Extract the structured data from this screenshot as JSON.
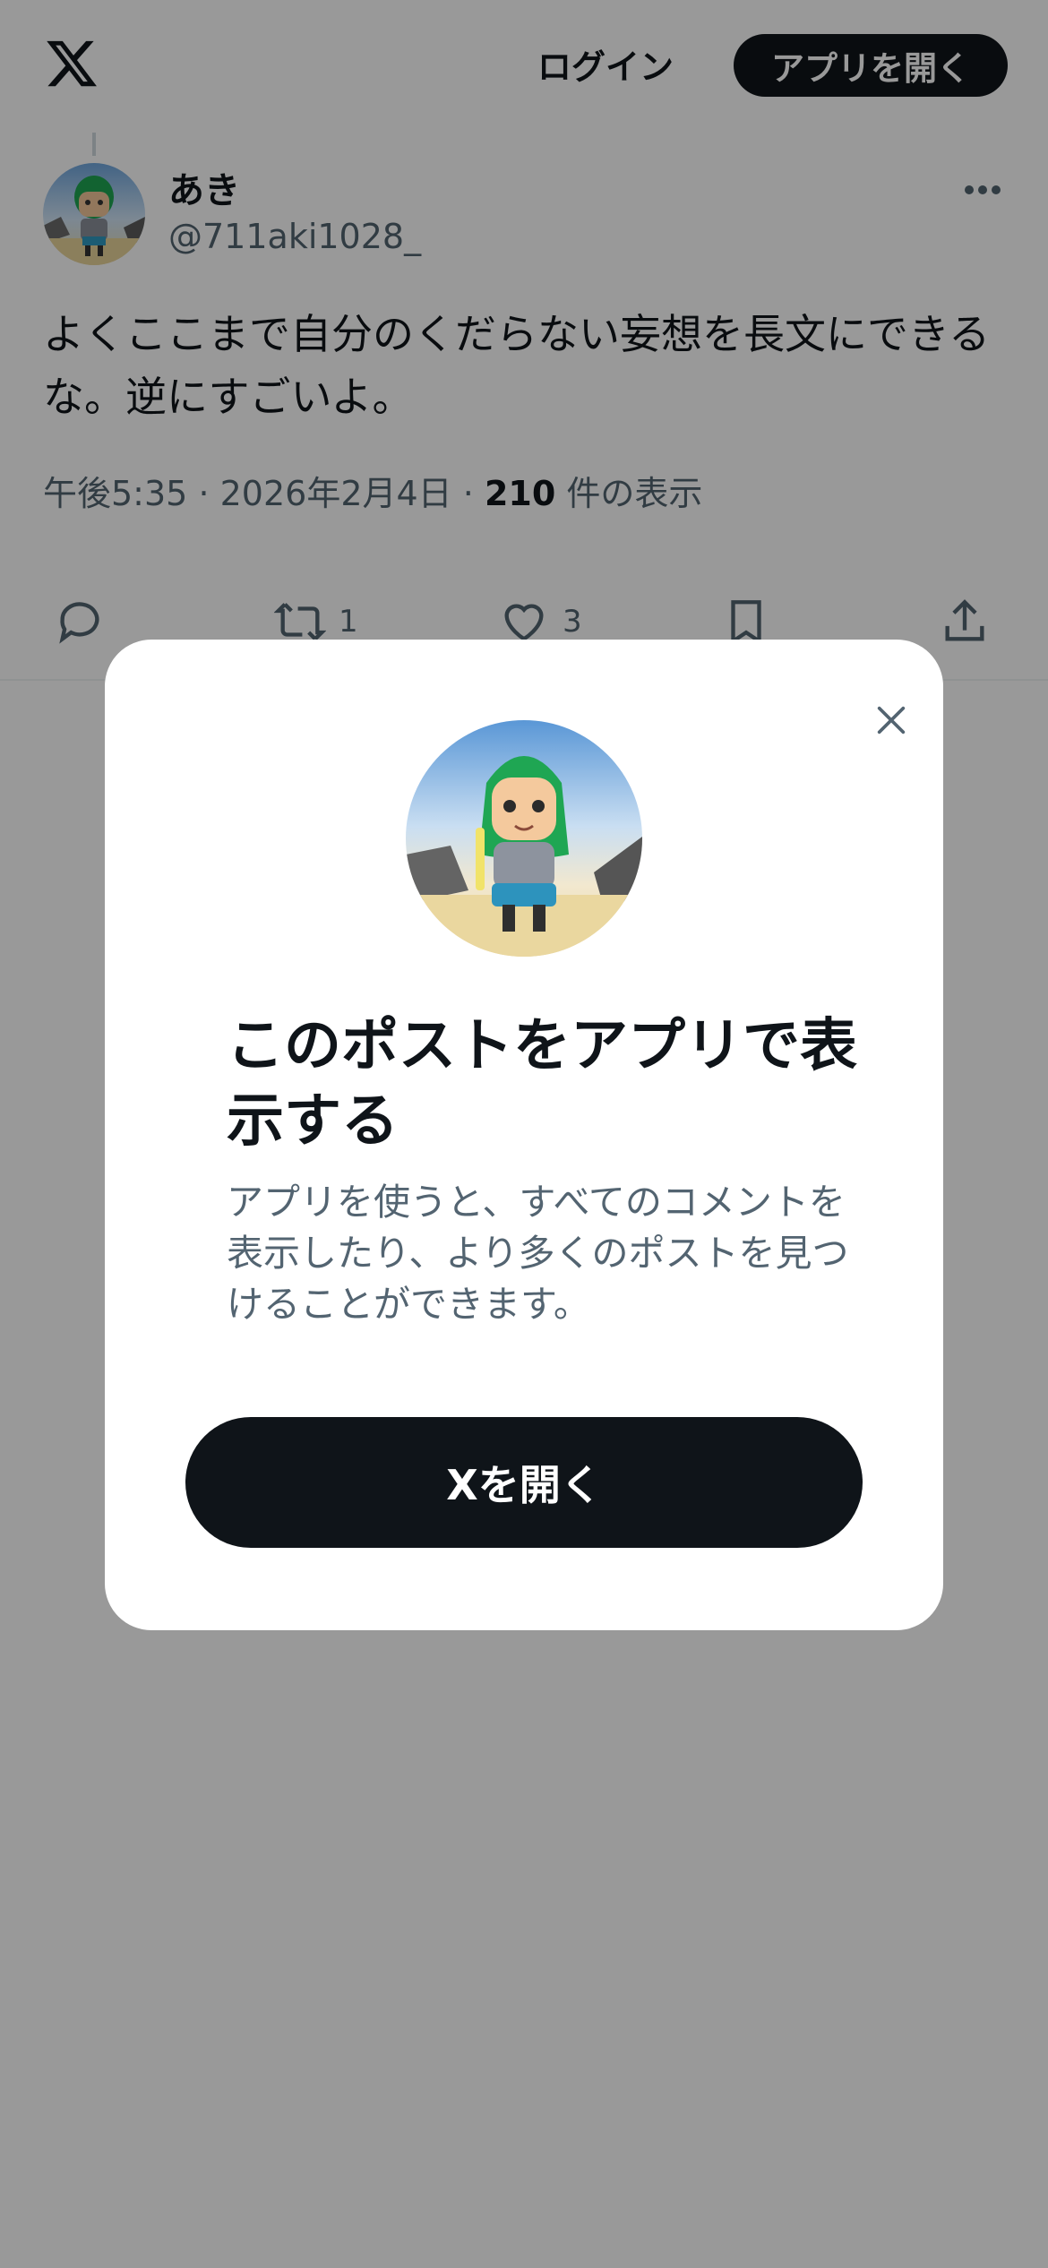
{
  "header": {
    "logo_icon": "x-logo-icon",
    "login_label": "ログイン",
    "open_app_label": "アプリを開く"
  },
  "tweet": {
    "display_name": "あき",
    "handle": "@711aki1028_",
    "text": "よくここまで自分のくだらない妄想を長文にできるな。逆にすごいよ。",
    "time": "午後5:35",
    "separator": "·",
    "date": "2026年2月4日",
    "views_count": "210",
    "views_label": "件の表示",
    "actions": {
      "reply_icon": "reply-icon",
      "retweet_icon": "retweet-icon",
      "retweet_count": "1",
      "like_icon": "heart-icon",
      "like_count": "3",
      "bookmark_icon": "bookmark-icon",
      "share_icon": "share-icon"
    }
  },
  "modal": {
    "title": "このポストをアプリで表示する",
    "description": "アプリを使うと、すべてのコメントを表示したり、より多くのポストを見つけることができます。",
    "cta_label": "Xを開く",
    "close_icon": "close-icon"
  },
  "colors": {
    "text_primary": "#0f1419",
    "text_secondary": "#536471",
    "overlay": "rgba(0,0,0,0.4)",
    "button_dark": "#0f1419"
  }
}
